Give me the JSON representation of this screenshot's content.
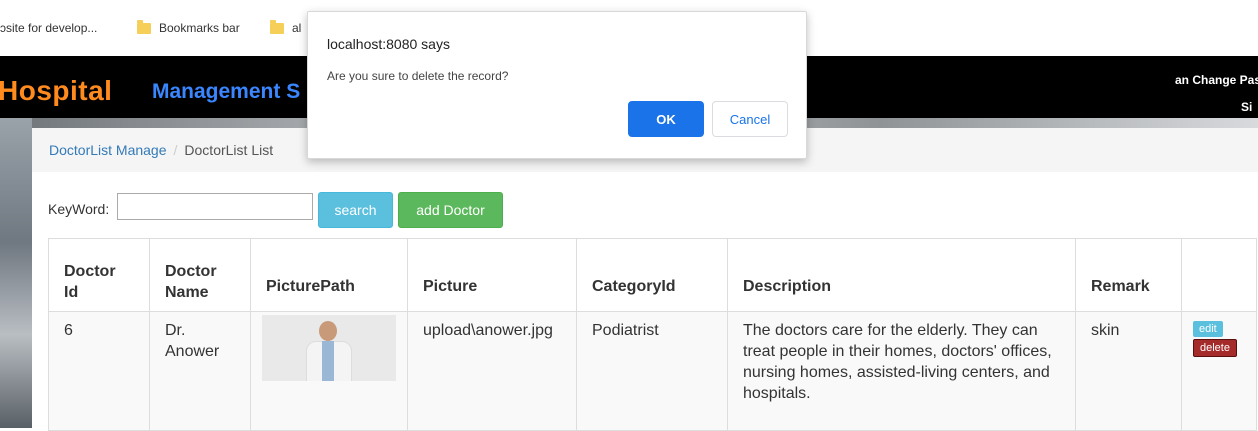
{
  "bookmarks": {
    "item1": "ɔsite for develop...",
    "item2": "Bookmarks bar",
    "item3": "al"
  },
  "header": {
    "brand_primary": "Hospital",
    "brand_secondary": "Management S",
    "user_text": "an  Change Pas",
    "sign_text": "Si"
  },
  "breadcrumb": {
    "link": "DoctorList Manage",
    "separator": "/",
    "current": "DoctorList List"
  },
  "search": {
    "label": "KeyWord:",
    "value": "",
    "button": "search",
    "add_button": "add Doctor"
  },
  "table": {
    "headers": {
      "id_line1": "Doctor",
      "id_line2": "Id",
      "name_line1": "Doctor",
      "name_line2": "Name",
      "picture_path": "PicturePath",
      "picture": "Picture",
      "category": "CategoryId",
      "description": "Description",
      "remark": "Remark",
      "actions": ""
    },
    "rows": [
      {
        "id": "6",
        "name_line1": "Dr.",
        "name_line2": "Anower",
        "picture_path": "",
        "picture": "upload\\anower.jpg",
        "category": "Podiatrist",
        "description": "The doctors care for the elderly. They can treat people in their homes, doctors' offices, nursing homes, assisted-living centers, and hospitals.",
        "remark": "skin",
        "edit": "edit",
        "delete": "delete"
      }
    ]
  },
  "dialog": {
    "title": "localhost:8080 says",
    "message": "Are you sure to delete the record?",
    "ok": "OK",
    "cancel": "Cancel"
  },
  "colors": {
    "brand_orange": "#ff8a1e",
    "brand_blue": "#3a86ff",
    "ok_blue": "#1a73e8",
    "search_btn": "#5bc0de",
    "add_btn": "#5cb85c",
    "delete_btn": "#a52a2a"
  }
}
